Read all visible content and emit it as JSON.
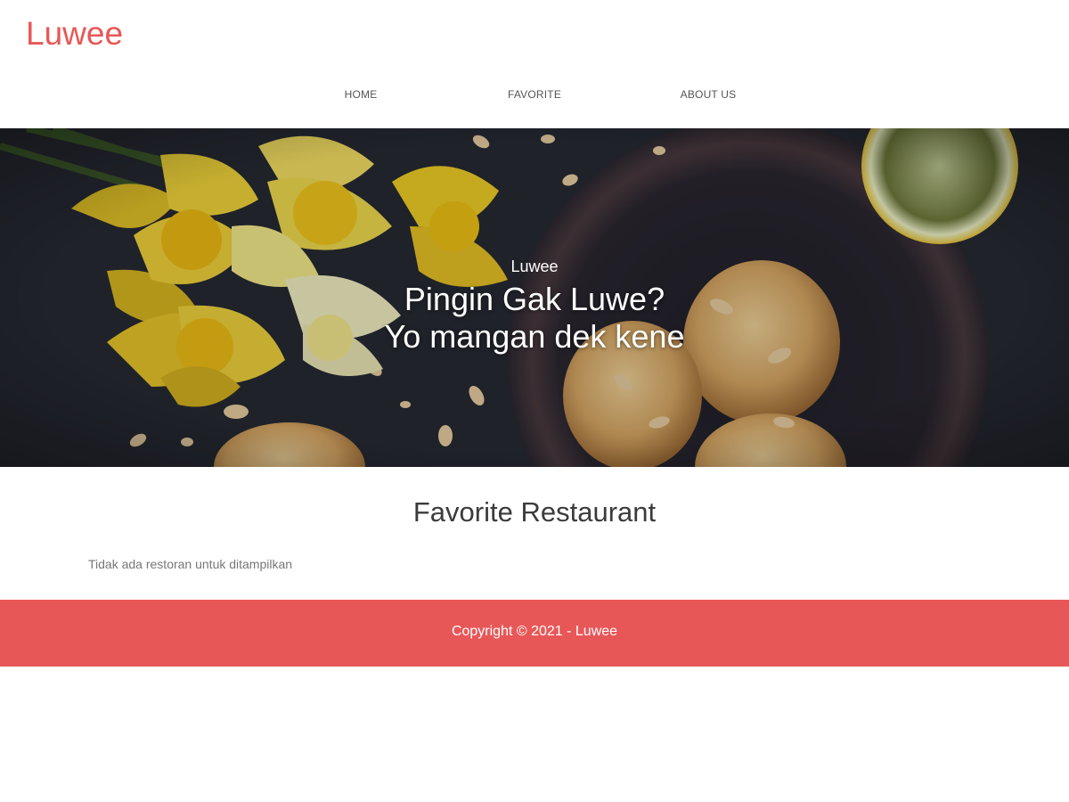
{
  "header": {
    "brand": "Luwee",
    "nav": [
      {
        "label": "HOME"
      },
      {
        "label": "FAVORITE"
      },
      {
        "label": "ABOUT US"
      }
    ]
  },
  "hero": {
    "tagline": "Luwee",
    "headline_line1": "Pingin Gak Luwe?",
    "headline_line2": "Yo mangan dek kene"
  },
  "main": {
    "title": "Favorite Restaurant",
    "empty_message": "Tidak ada restoran untuk ditampilkan"
  },
  "footer": {
    "copyright": "Copyright © 2021 - Luwee"
  },
  "colors": {
    "brand": "#e85757",
    "hero_background": "#272a33",
    "text_dark": "#3b3b3b",
    "text_muted": "#777777"
  }
}
